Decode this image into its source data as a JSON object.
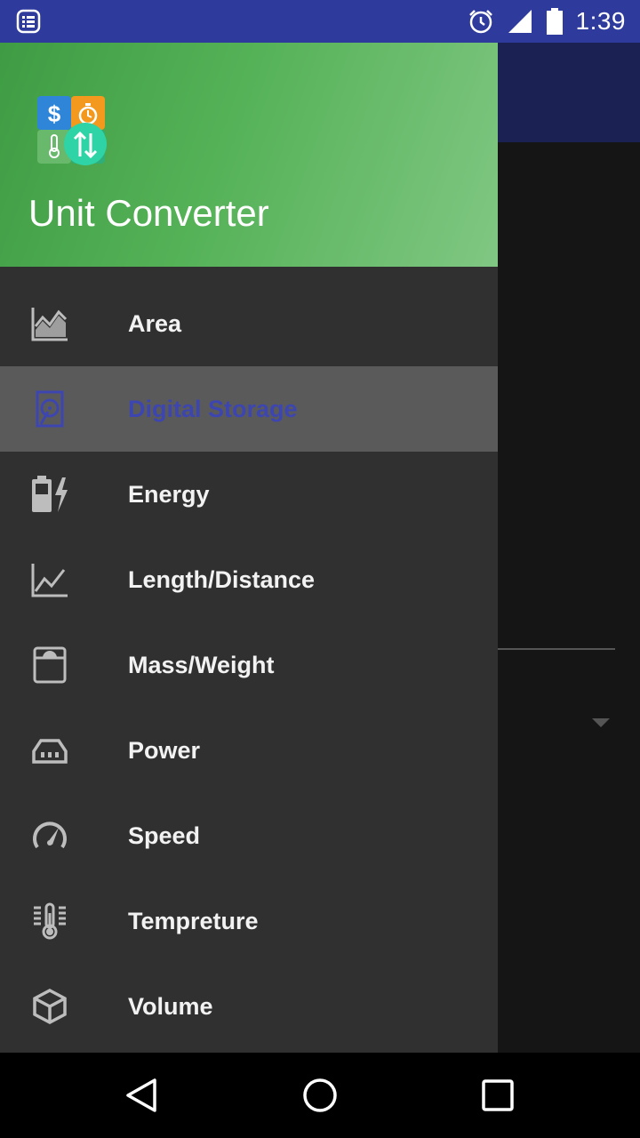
{
  "status_bar": {
    "time": "1:39",
    "icons": [
      "notification-list-icon",
      "alarm-icon",
      "signal-icon",
      "battery-icon"
    ]
  },
  "drawer": {
    "app_title": "Unit Converter",
    "logo_icon": "unit-converter-logo",
    "selected_index": 1,
    "items": [
      {
        "label": "Area",
        "icon": "area-chart-icon"
      },
      {
        "label": "Digital Storage",
        "icon": "sd-card-icon"
      },
      {
        "label": "Energy",
        "icon": "battery-bolt-icon"
      },
      {
        "label": "Length/Distance",
        "icon": "line-chart-icon"
      },
      {
        "label": "Mass/Weight",
        "icon": "scale-icon"
      },
      {
        "label": "Power",
        "icon": "power-socket-icon"
      },
      {
        "label": "Speed",
        "icon": "speedometer-icon"
      },
      {
        "label": "Tempreture",
        "icon": "thermometer-icon"
      },
      {
        "label": "Volume",
        "icon": "cube-icon"
      }
    ]
  },
  "colors": {
    "status_bar": "#2e3b9c",
    "header_gradient_start": "#3f9c44",
    "header_gradient_end": "#80c783",
    "drawer_background": "#303030",
    "selected_background": "#5a5a5a",
    "selected_text": "#3d46b0"
  },
  "nav_bar": {
    "buttons": [
      "back-icon",
      "home-icon",
      "recents-icon"
    ]
  }
}
